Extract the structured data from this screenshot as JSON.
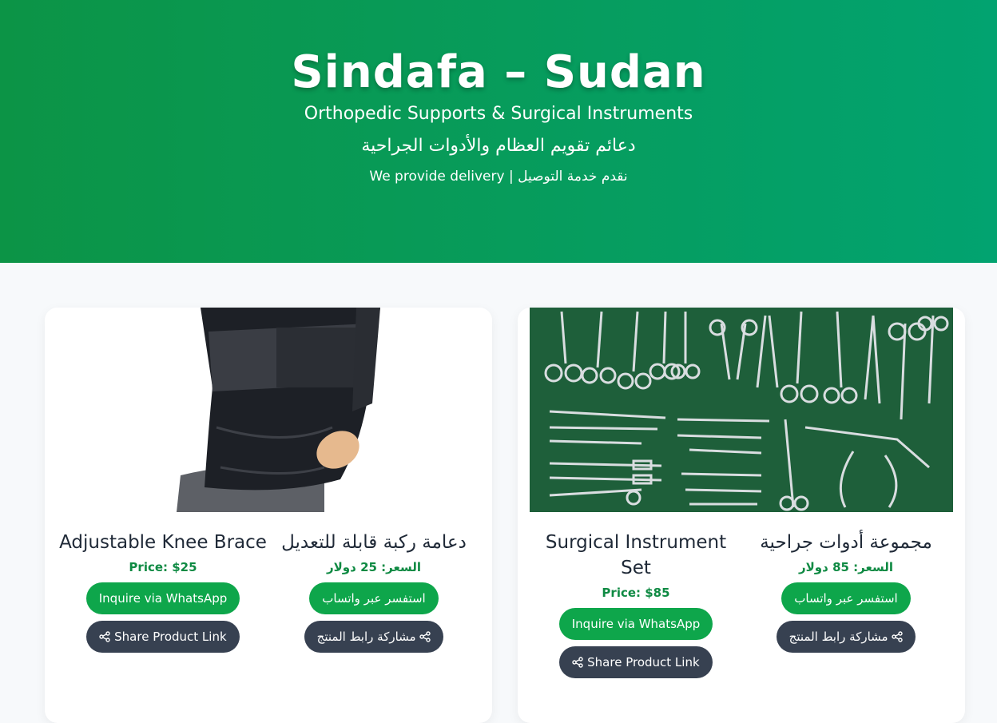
{
  "header": {
    "title": "Sindafa – Sudan",
    "subtitle_en": "Orthopedic Supports & Surgical Instruments",
    "subtitle_ar": "دعائم تقويم العظام والأدوات الجراحية",
    "delivery": "We provide delivery | نقدم خدمة التوصيل"
  },
  "products": [
    {
      "image_alt": "knee-brace-photo",
      "name_en": "Adjustable Knee Brace",
      "name_ar": "دعامة ركبة قابلة للتعديل",
      "price_en": "Price: $25",
      "price_ar": "السعر: 25 دولار",
      "whatsapp_en": "Inquire via WhatsApp",
      "whatsapp_ar": "استفسر عبر واتساب",
      "share_en": "Share Product Link",
      "share_ar": "مشاركة رابط المنتج"
    },
    {
      "image_alt": "surgical-instruments-photo",
      "name_en": "Surgical Instrument Set",
      "name_ar": "مجموعة أدوات جراحية",
      "price_en": "Price: $85",
      "price_ar": "السعر: 85 دولار",
      "whatsapp_en": "Inquire via WhatsApp",
      "whatsapp_ar": "استفسر عبر واتساب",
      "share_en": "Share Product Link",
      "share_ar": "مشاركة رابط المنتج"
    }
  ],
  "colors": {
    "brand_green": "#0c9446",
    "brand_teal": "#02a370",
    "whatsapp_button": "#0ea64b",
    "share_button": "#374151",
    "price_text": "#0f8a43"
  },
  "icons": {
    "share": "share-icon"
  }
}
